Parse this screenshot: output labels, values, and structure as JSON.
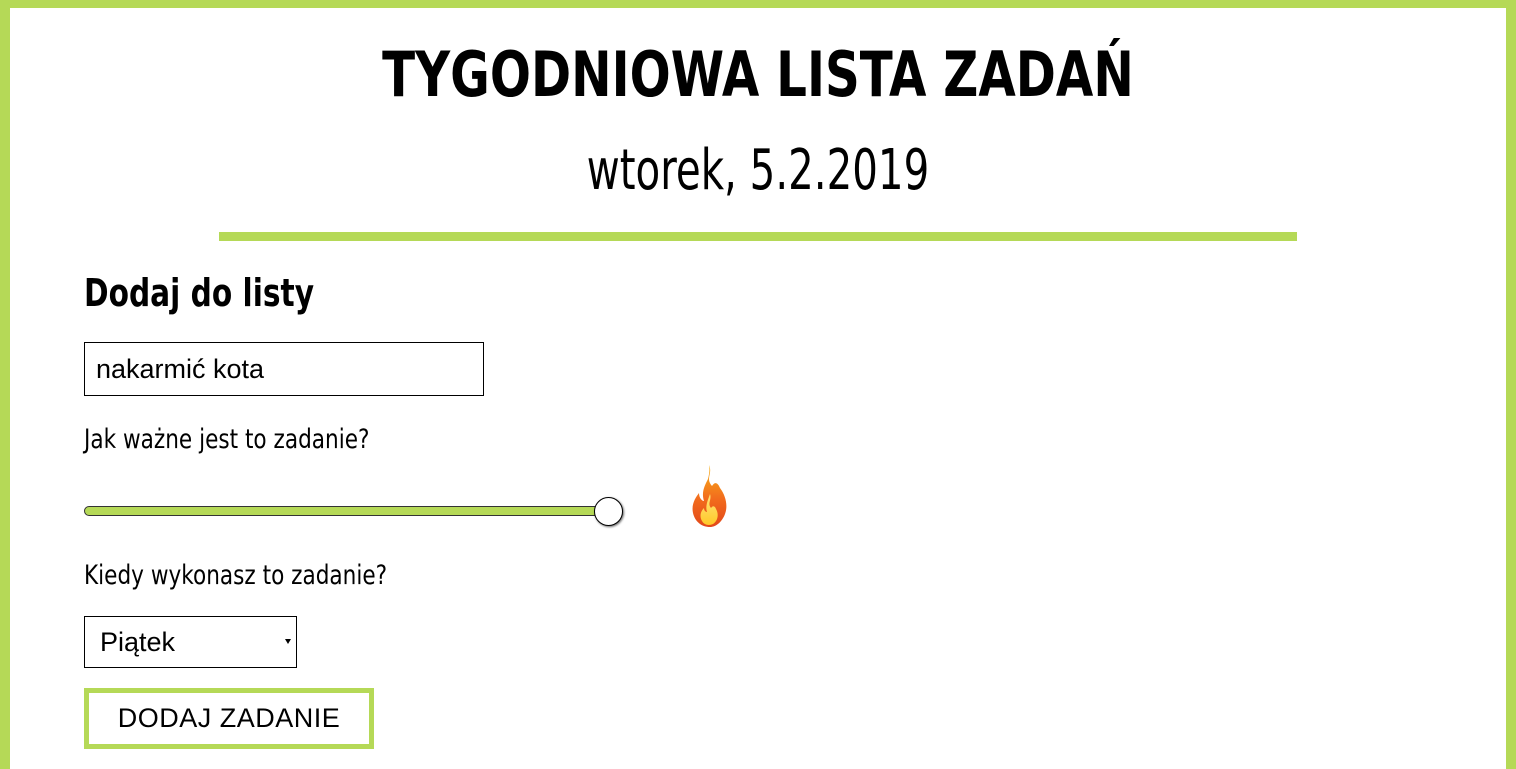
{
  "header": {
    "title": "TYGODNIOWA LISTA ZADAŃ",
    "date": "wtorek, 5.2.2019"
  },
  "form": {
    "heading": "Dodaj do listy",
    "task_input": {
      "value": "nakarmić kota"
    },
    "priority": {
      "label": "Jak ważne jest to zadanie?",
      "value_fraction": 1.0,
      "indicator_icon": "fire-icon"
    },
    "day": {
      "label": "Kiedy wykonasz to zadanie?",
      "selected": "Piątek"
    },
    "submit_label": "DODAJ ZADANIE"
  },
  "colors": {
    "accent": "#b5d957",
    "text": "#000000",
    "background": "#ffffff"
  }
}
